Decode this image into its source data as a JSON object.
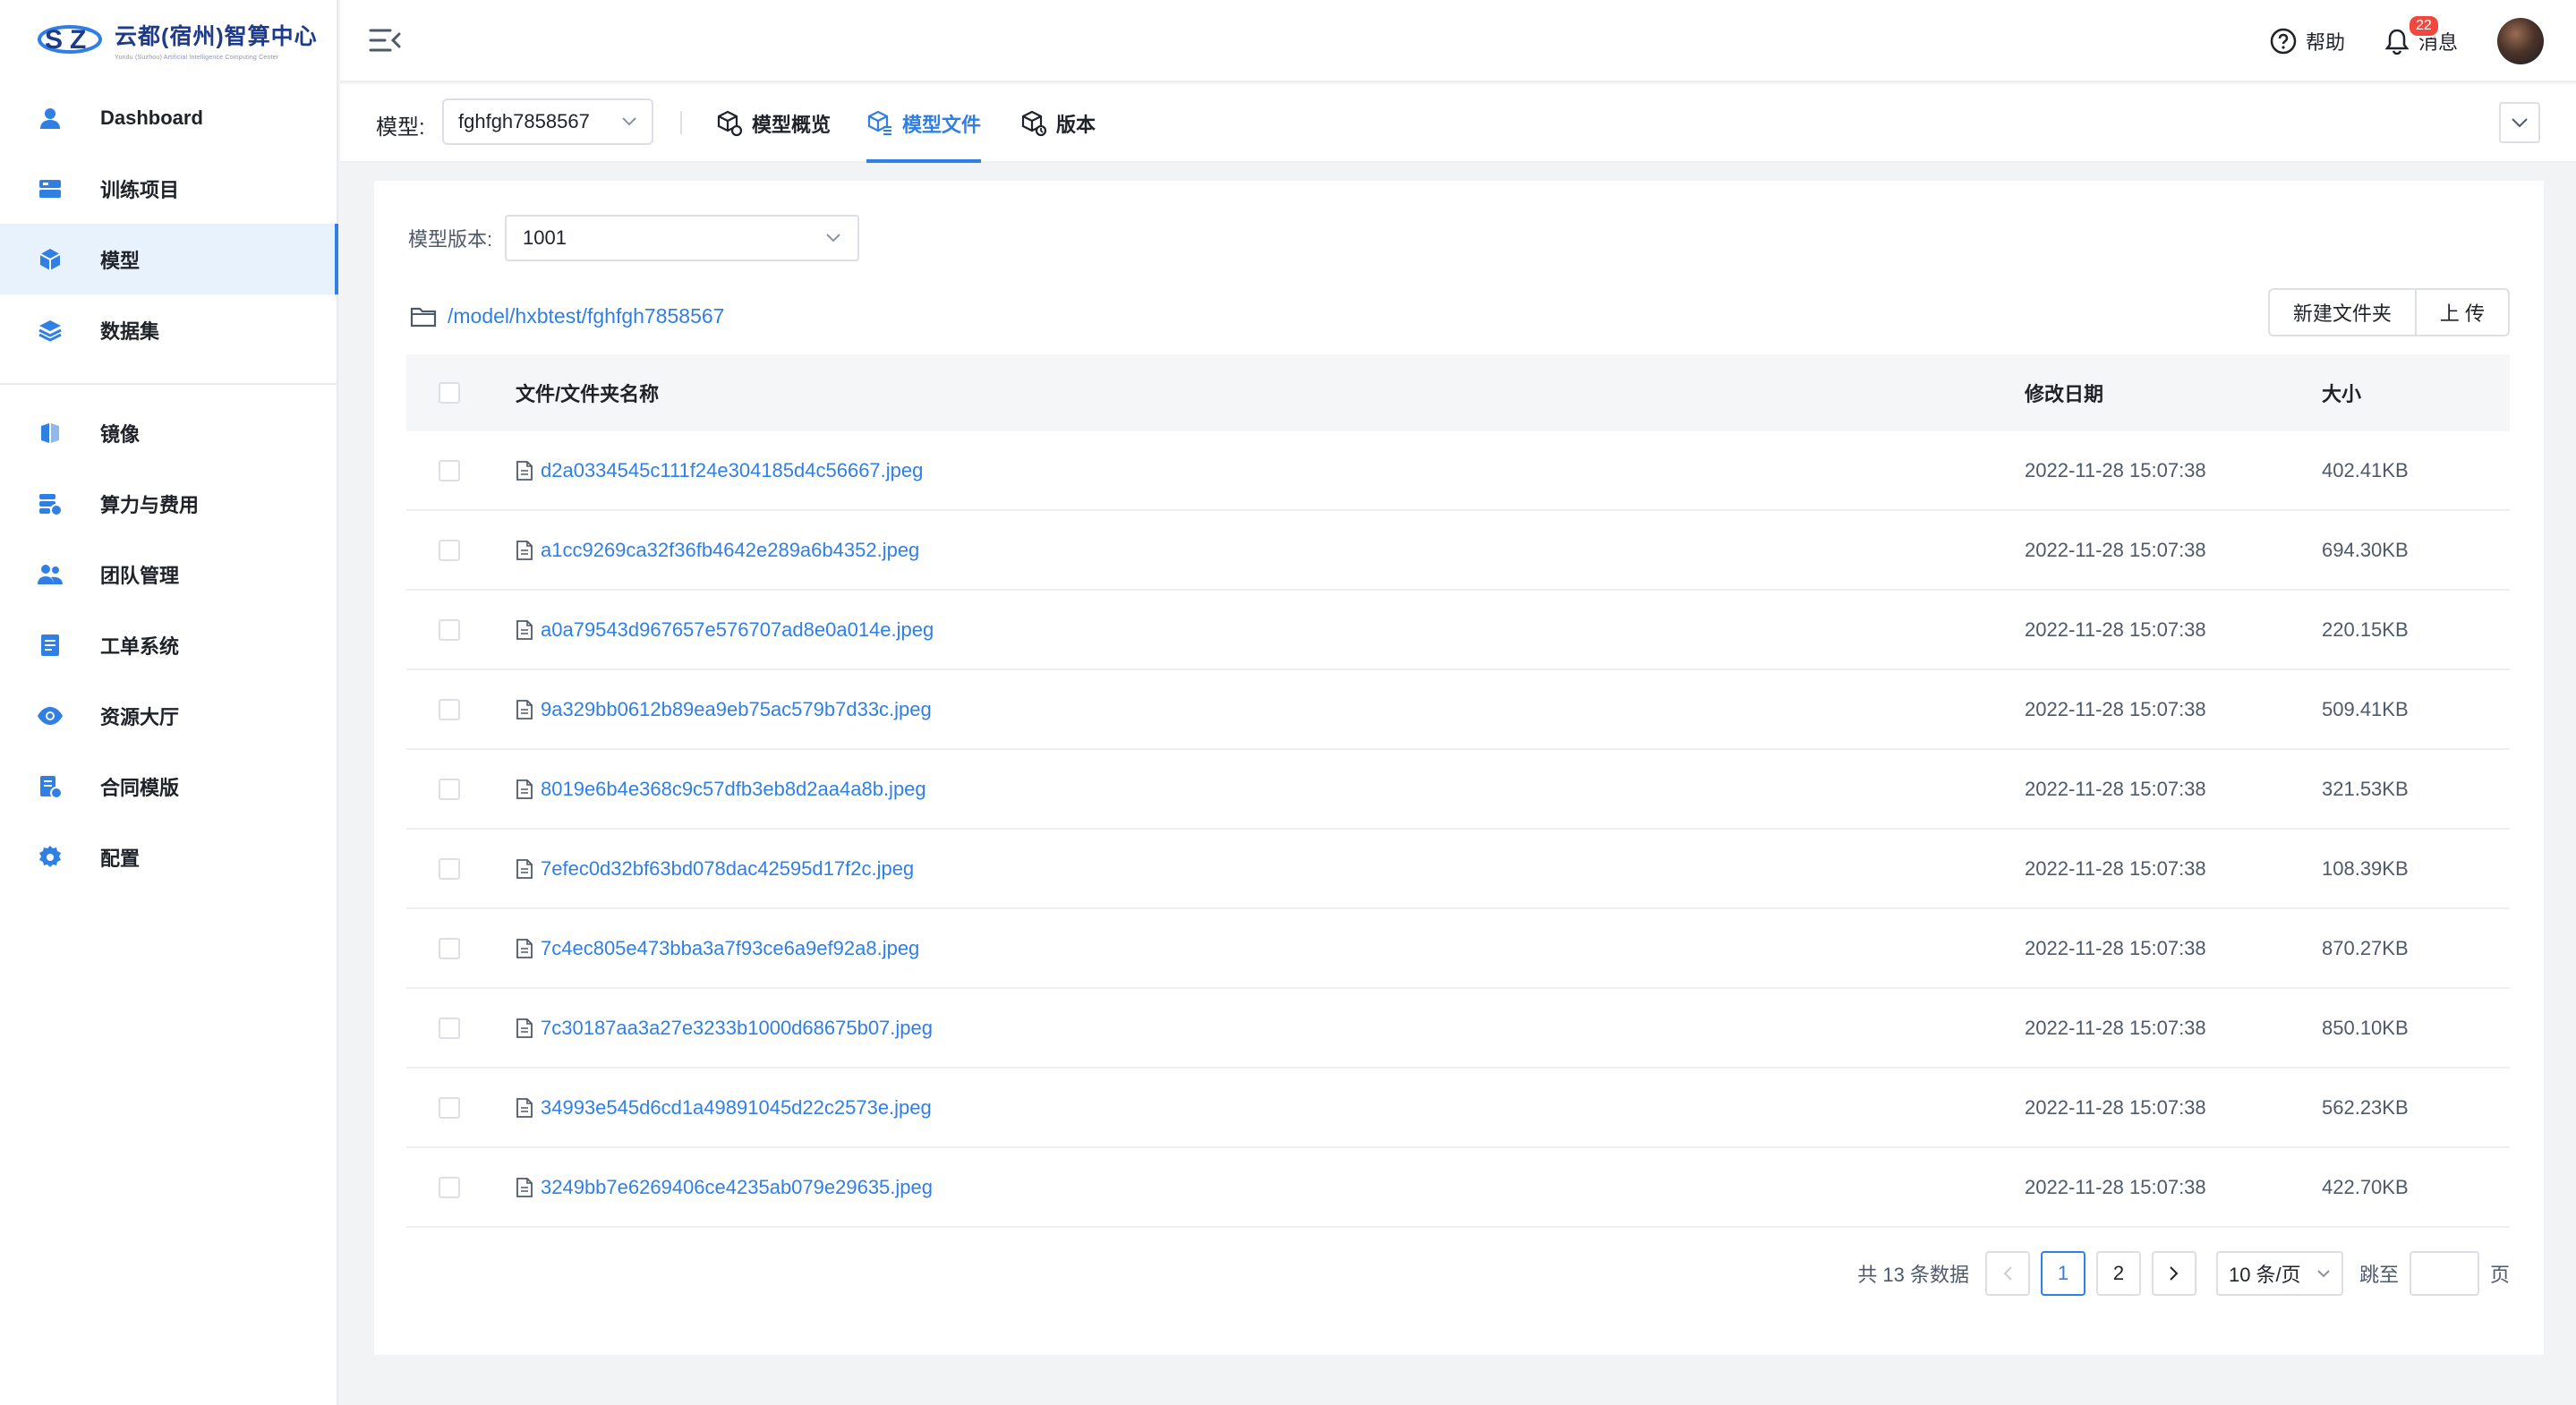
{
  "app": {
    "title": "云都(宿州)智算中心",
    "subtitle": "Yundu (Suzhou) Artificial Intelligence Computing Center"
  },
  "sidebar": {
    "items": [
      {
        "label": "Dashboard",
        "icon": "user-icon"
      },
      {
        "label": "训练项目",
        "icon": "server-icon"
      },
      {
        "label": "模型",
        "icon": "cube-icon",
        "active": true
      },
      {
        "label": "数据集",
        "icon": "layers-icon"
      },
      {
        "label": "镜像",
        "icon": "mirror-icon"
      },
      {
        "label": "算力与费用",
        "icon": "compute-cost-icon"
      },
      {
        "label": "团队管理",
        "icon": "team-icon"
      },
      {
        "label": "工单系统",
        "icon": "ticket-icon"
      },
      {
        "label": "资源大厅",
        "icon": "eye-icon"
      },
      {
        "label": "合同模版",
        "icon": "contract-icon"
      },
      {
        "label": "配置",
        "icon": "settings-icon"
      }
    ]
  },
  "header": {
    "help_label": "帮助",
    "messages_label": "消息",
    "messages_count": "22"
  },
  "tabsbar": {
    "model_label": "模型:",
    "model_value": "fghfgh7858567",
    "tabs": [
      {
        "label": "模型概览",
        "icon": "model-overview-icon"
      },
      {
        "label": "模型文件",
        "icon": "model-files-icon",
        "active": true
      },
      {
        "label": "版本",
        "icon": "version-icon"
      }
    ]
  },
  "files": {
    "version_label": "模型版本:",
    "version_value": "1001",
    "path": "/model/hxbtest/fghfgh7858567",
    "new_folder_label": "新建文件夹",
    "upload_label": "上 传",
    "columns": {
      "name": "文件/文件夹名称",
      "date": "修改日期",
      "size": "大小"
    },
    "rows": [
      {
        "name": "d2a0334545c111f24e304185d4c56667.jpeg",
        "date": "2022-11-28 15:07:38",
        "size": "402.41KB"
      },
      {
        "name": "a1cc9269ca32f36fb4642e289a6b4352.jpeg",
        "date": "2022-11-28 15:07:38",
        "size": "694.30KB"
      },
      {
        "name": "a0a79543d967657e576707ad8e0a014e.jpeg",
        "date": "2022-11-28 15:07:38",
        "size": "220.15KB"
      },
      {
        "name": "9a329bb0612b89ea9eb75ac579b7d33c.jpeg",
        "date": "2022-11-28 15:07:38",
        "size": "509.41KB"
      },
      {
        "name": "8019e6b4e368c9c57dfb3eb8d2aa4a8b.jpeg",
        "date": "2022-11-28 15:07:38",
        "size": "321.53KB"
      },
      {
        "name": "7efec0d32bf63bd078dac42595d17f2c.jpeg",
        "date": "2022-11-28 15:07:38",
        "size": "108.39KB"
      },
      {
        "name": "7c4ec805e473bba3a7f93ce6a9ef92a8.jpeg",
        "date": "2022-11-28 15:07:38",
        "size": "870.27KB"
      },
      {
        "name": "7c30187aa3a27e3233b1000d68675b07.jpeg",
        "date": "2022-11-28 15:07:38",
        "size": "850.10KB"
      },
      {
        "name": "34993e545d6cd1a49891045d22c2573e.jpeg",
        "date": "2022-11-28 15:07:38",
        "size": "562.23KB"
      },
      {
        "name": "3249bb7e6269406ce4235ab079e29635.jpeg",
        "date": "2022-11-28 15:07:38",
        "size": "422.70KB"
      }
    ]
  },
  "pagination": {
    "total_text": "共 13 条数据",
    "pages": [
      "1",
      "2"
    ],
    "current_page": "1",
    "page_size": "10 条/页",
    "jump_label": "跳至",
    "page_suffix": "页"
  },
  "colors": {
    "accent": "#2f7fe5",
    "active_bg": "#e8f2fd",
    "badge": "#f0483e"
  }
}
